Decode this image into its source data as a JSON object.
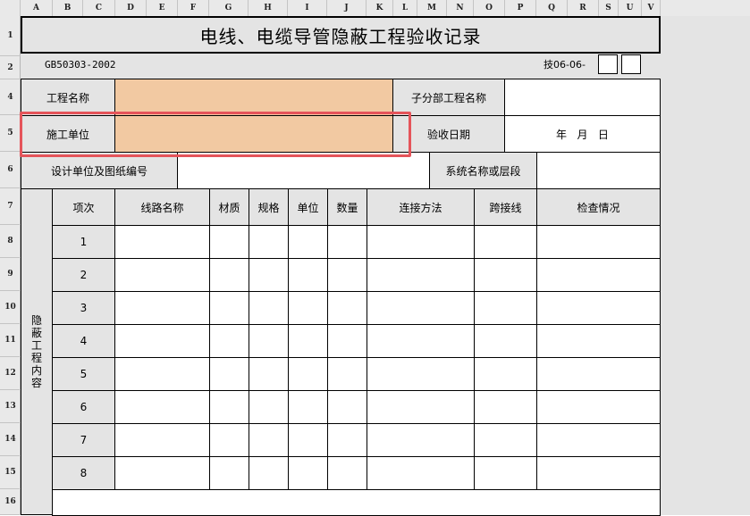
{
  "col_headers": [
    "A",
    "B",
    "C",
    "D",
    "E",
    "F",
    "G",
    "H",
    "I",
    "J",
    "K",
    "L",
    "M",
    "N",
    "O",
    "P",
    "Q",
    "R",
    "S",
    "U",
    "V"
  ],
  "row_headers": [
    "1",
    "2",
    "4",
    "5",
    "6",
    "7",
    "8",
    "9",
    "10",
    "11",
    "12",
    "13",
    "14",
    "15",
    "16"
  ],
  "title": "电线、电缆导管隐蔽工程验收记录",
  "standard_code": "GB50303-2002",
  "form_code": "技06-06-",
  "project_name_label": "工程名称",
  "sub_project_label": "子分部工程名称",
  "construction_unit_label": "施工单位",
  "acceptance_date_label": "验收日期",
  "date_placeholder": "年   月   日",
  "design_unit_label": "设计单位及图纸编号",
  "system_name_label": "系统名称或层段",
  "section_label_chars": [
    "隐",
    "蔽",
    "工",
    "程",
    "内",
    "容"
  ],
  "table_headers": {
    "item_no": "项次",
    "line_name": "线路名称",
    "material": "材质",
    "spec": "规格",
    "unit": "单位",
    "quantity": "数量",
    "connection": "连接方法",
    "jumper": "跨接线",
    "inspection": "检查情况"
  },
  "item_numbers": [
    "1",
    "2",
    "3",
    "4",
    "5",
    "6",
    "7",
    "8"
  ]
}
